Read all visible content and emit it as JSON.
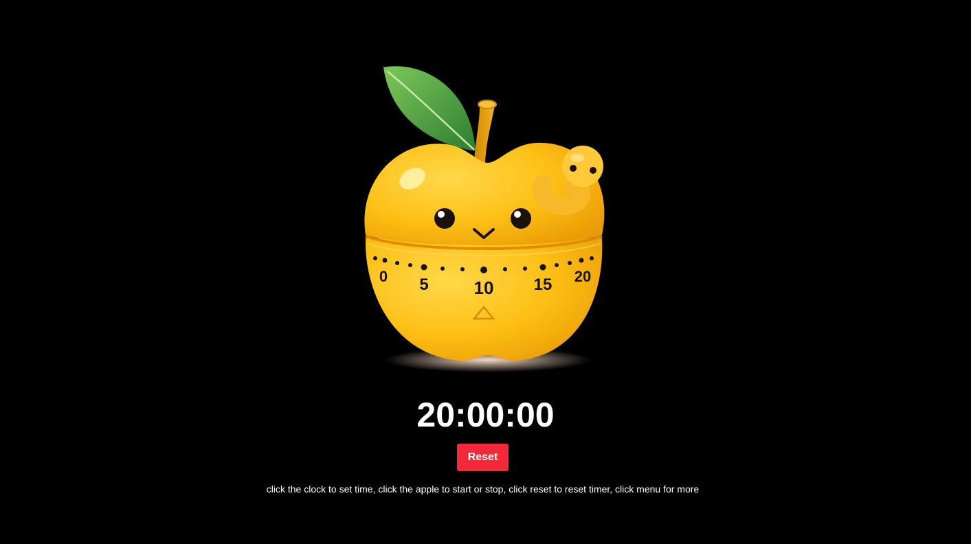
{
  "timer": {
    "display": "20:00:00",
    "dial_numbers": [
      "0",
      "5",
      "10",
      "15",
      "20"
    ]
  },
  "controls": {
    "reset_label": "Reset"
  },
  "hint": {
    "text": "click the clock to set time, click the apple to start or stop, click reset to reset timer, click menu for more"
  },
  "colors": {
    "background": "#000000",
    "apple": "#FDBF14",
    "reset_button": "#F3293A",
    "text": "#FFFFFF"
  },
  "icons": {
    "apple": "apple-timer-icon",
    "worm": "worm-icon",
    "leaf": "leaf-icon"
  }
}
